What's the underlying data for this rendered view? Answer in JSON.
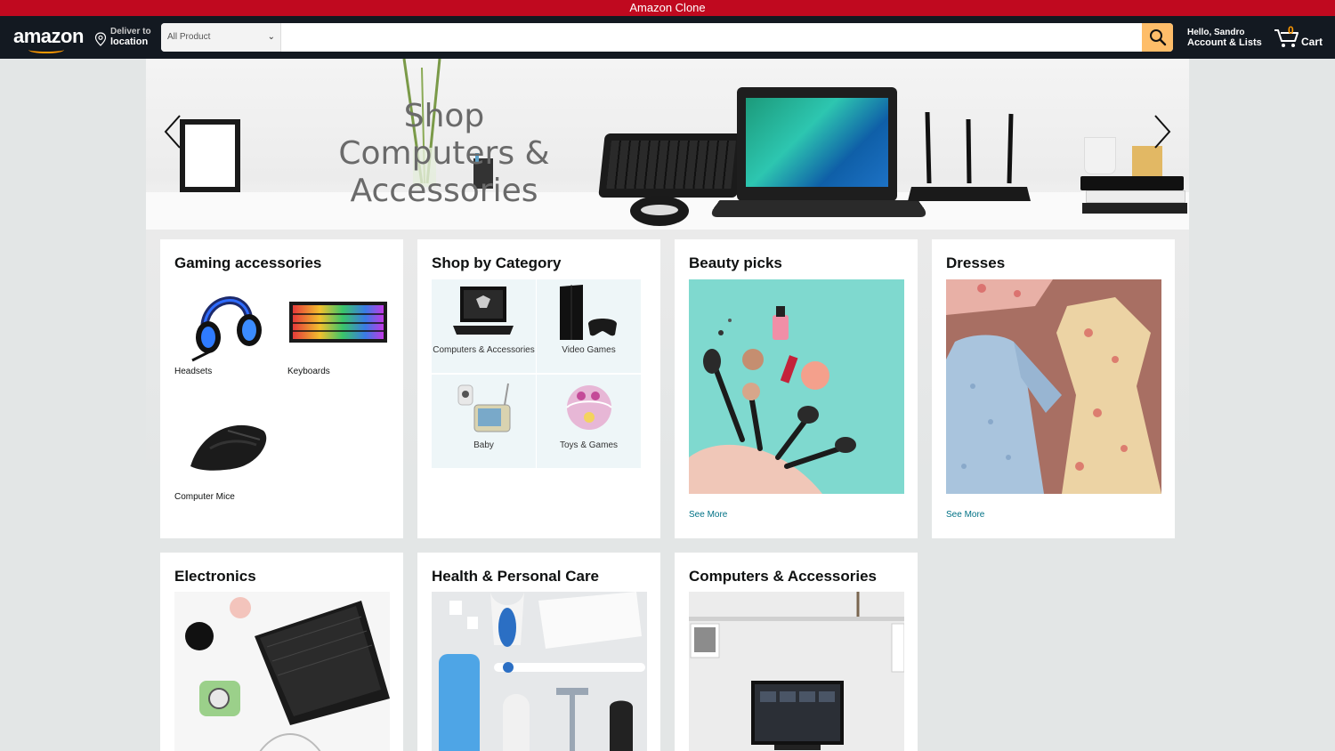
{
  "topbar": {
    "title": "Amazon Clone"
  },
  "nav": {
    "logo": "amazon",
    "deliver_line1": "Deliver to",
    "deliver_line2": "location",
    "search_category": "All Product",
    "search_placeholder": "",
    "account_line1": "Hello, Sandro",
    "account_line2": "Account & Lists",
    "cart_count": "0",
    "cart_label": "Cart"
  },
  "hero": {
    "title": "Shop Computers & Accessories"
  },
  "cards": {
    "gaming": {
      "title": "Gaming accessories",
      "items": [
        "Headsets",
        "Keyboards",
        "Computer Mice"
      ]
    },
    "category": {
      "title": "Shop by Category",
      "items": [
        "Computers & Accessories",
        "Video Games",
        "Baby",
        "Toys & Games"
      ]
    },
    "beauty": {
      "title": "Beauty picks",
      "see_more": "See More"
    },
    "dresses": {
      "title": "Dresses",
      "see_more": "See More"
    },
    "electronics": {
      "title": "Electronics"
    },
    "health": {
      "title": "Health & Personal Care"
    },
    "computers": {
      "title": "Computers & Accessories"
    }
  },
  "colors": {
    "topbar": "#c0091f",
    "navbar": "#131921",
    "search_button": "#febd69",
    "accent": "#ff9900",
    "link": "#007185"
  }
}
